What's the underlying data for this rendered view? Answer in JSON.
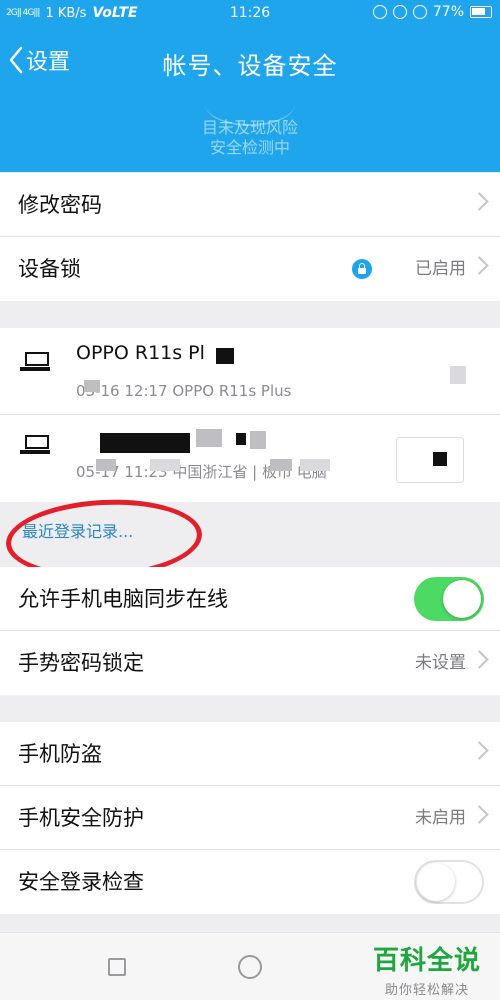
{
  "status_bar": {
    "signal": "2G|| 4G|||",
    "speed": "1 KB/s",
    "network": "VoLTE",
    "time": "11:26",
    "battery": "77%"
  },
  "nav": {
    "back_label": "设置",
    "title": "帐号、设备安全"
  },
  "banner": {
    "line1": "目未及现风险",
    "line2": "安全检测中"
  },
  "security_group": {
    "items": [
      {
        "label": "修改密码"
      },
      {
        "label": "设备锁",
        "value": "已启用"
      }
    ]
  },
  "devices": [
    {
      "name": "OPPO R11s Pl",
      "sub": "03-16 12:17 OPPO R11s Plus"
    },
    {
      "name": "",
      "sub": "05-17 11:23 中国浙江省 | 板市 电脑"
    }
  ],
  "recent_login": "最近登录记录...",
  "sync_group": {
    "items": [
      {
        "label": "允许手机电脑同步在线",
        "toggle": true
      },
      {
        "label": "手势密码锁定",
        "value": "未设置"
      }
    ]
  },
  "protection_group": {
    "items": [
      {
        "label": "手机防盗"
      },
      {
        "label": "手机安全防护",
        "value": "未启用"
      },
      {
        "label": "安全登录检查",
        "toggle": false
      }
    ]
  },
  "watermark": {
    "title": "百科全说",
    "subtitle": "助你轻松解决"
  },
  "colors": {
    "header": "#1fa5ec",
    "toggle_on": "#4cd964",
    "link": "#2a86c9",
    "annotation": "#e21f2a",
    "watermark": "#1fa73f"
  }
}
